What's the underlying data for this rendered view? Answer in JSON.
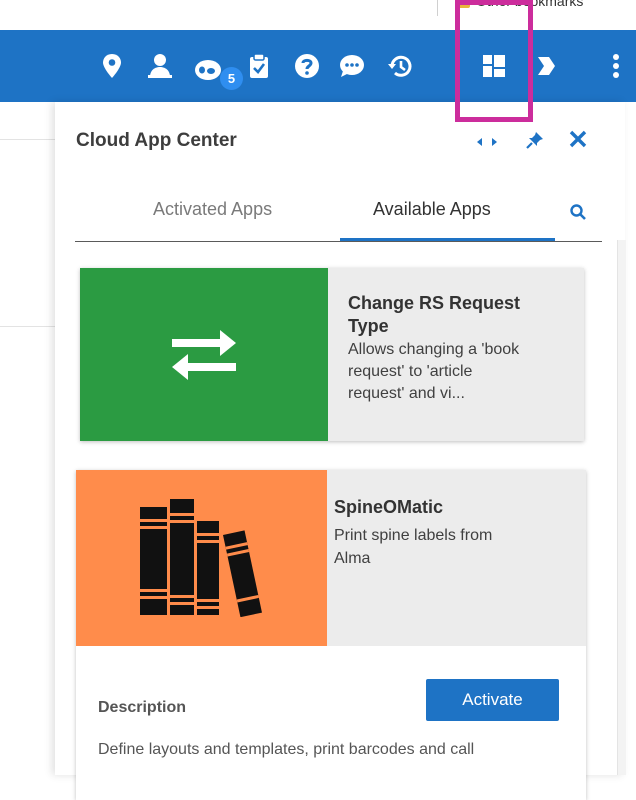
{
  "browser": {
    "bookmark_label": "Other bookmarks"
  },
  "toolbar": {
    "background": "#1e73c5",
    "icons": [
      "location-icon",
      "user-icon",
      "tasks-icon",
      "clipboard-icon",
      "help-icon",
      "chat-icon",
      "history-icon",
      "apps-grid-icon",
      "pin-icon",
      "more-vert-icon"
    ],
    "task_badge": "5",
    "highlight_color": "#cc2d9c"
  },
  "panel": {
    "title": "Cloud App Center",
    "tabs": [
      {
        "label": "Activated Apps",
        "active": false
      },
      {
        "label": "Available Apps",
        "active": true
      }
    ]
  },
  "apps": [
    {
      "title": "Change RS Request Type",
      "title_line1": "Change RS Request",
      "title_line2": "Type",
      "description_lines": [
        "Allows changing a 'book",
        "request' to 'article",
        "request' and vi..."
      ],
      "color": "#2b9b42",
      "icon": "swap-arrows-icon"
    },
    {
      "title": "SpineOMatic",
      "description_lines": [
        "Print spine labels from",
        "Alma"
      ],
      "color": "#ff8c4b",
      "icon": "books-icon",
      "description_label": "Description",
      "action_label": "Activate",
      "long_description": "Define layouts and templates, print barcodes and call"
    }
  ]
}
